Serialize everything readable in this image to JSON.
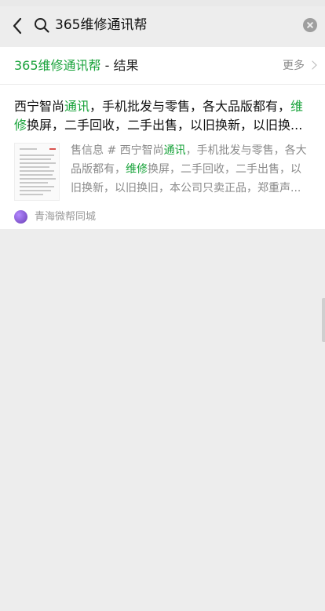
{
  "search": {
    "query": "365维修通讯帮"
  },
  "section": {
    "title_highlight": "365维修通讯帮",
    "title_suffix": " - 结果",
    "more_label": "更多"
  },
  "result": {
    "title_parts": [
      {
        "text": "西宁智尚",
        "hl": false
      },
      {
        "text": "通讯",
        "hl": true
      },
      {
        "text": "，手机批发与零售，各大品版都有，",
        "hl": false
      },
      {
        "text": "维修",
        "hl": true
      },
      {
        "text": "换屏，二手回收，二手出售，以旧换新，以旧换...",
        "hl": false
      }
    ],
    "snippet_parts": [
      {
        "text": "售信息 # 西宁智尚",
        "hl": false
      },
      {
        "text": "通讯",
        "hl": true
      },
      {
        "text": "，手机批发与零售，各大品版都有，",
        "hl": false
      },
      {
        "text": "维修",
        "hl": true
      },
      {
        "text": "换屏，二手回收，二手出售，以旧换新，以旧换旧，本公司只卖正品，郑重声...",
        "hl": false
      }
    ],
    "source_name": "青海微帮同城"
  },
  "colors": {
    "highlight": "#19a33b",
    "background": "#ededed",
    "card": "#ffffff"
  },
  "icons": {
    "back": "back-chevron-icon",
    "search": "search-icon",
    "clear": "clear-icon",
    "more": "chevron-right-icon"
  }
}
